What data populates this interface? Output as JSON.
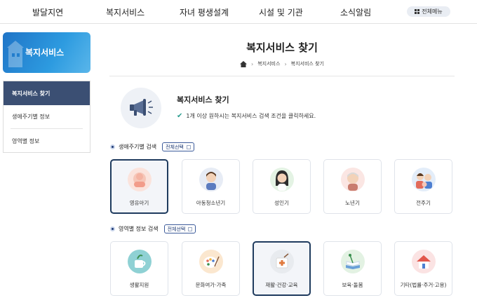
{
  "topnav": {
    "items": [
      "발달지연",
      "복지서비스",
      "자녀 평생설계",
      "시설 및 기관",
      "소식알림"
    ],
    "menu_label": "전체메뉴"
  },
  "sidebar": {
    "banner_title": "복지서비스",
    "items": [
      {
        "label": "복지서비스 찾기",
        "active": true
      },
      {
        "label": "생애주기별 정보",
        "active": false
      },
      {
        "label": "영역별 정보",
        "active": false
      }
    ]
  },
  "page": {
    "title": "복지서비스 찾기",
    "breadcrumb": [
      "복지서비스",
      "복지서비스 찾기"
    ]
  },
  "intro": {
    "title": "복지서비스 찾기",
    "desc": "1개 이상 원하시는 복지서비스 검색 조건을 클릭하세요."
  },
  "lifecycle": {
    "heading": "생애주기별 검색",
    "select_all": "전체선택",
    "cards": [
      {
        "label": "영유아기",
        "icon": "baby-icon",
        "selected": true
      },
      {
        "label": "아동청소년기",
        "icon": "child-icon",
        "selected": false
      },
      {
        "label": "성인기",
        "icon": "adult-icon",
        "selected": false
      },
      {
        "label": "노년기",
        "icon": "elder-icon",
        "selected": false
      },
      {
        "label": "전주기",
        "icon": "family-icon",
        "selected": false
      }
    ]
  },
  "domain": {
    "heading": "영역별 정보 검색",
    "select_all": "전체선택",
    "cards": [
      {
        "label": "생활지원",
        "icon": "cup-icon",
        "selected": false
      },
      {
        "label": "문화여가·가족",
        "icon": "palette-icon",
        "selected": false
      },
      {
        "label": "재활·건강·교육",
        "icon": "health-icon",
        "selected": true
      },
      {
        "label": "보육·돌봄",
        "icon": "book-icon",
        "selected": false
      },
      {
        "label": "기타(법률·주거·고용)",
        "icon": "house-icon",
        "selected": false
      }
    ]
  },
  "colors": {
    "accent": "#1f3b5e",
    "banner": "#2d9be0",
    "sidebar_active": "#3b4f73"
  }
}
